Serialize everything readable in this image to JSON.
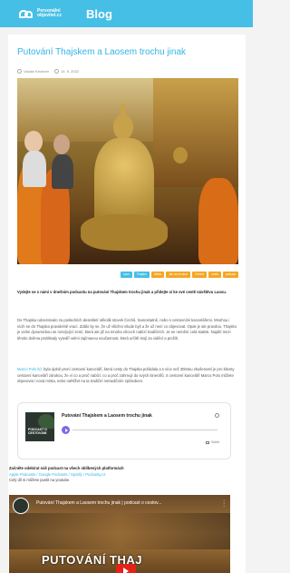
{
  "header": {
    "logo_text": "Personální\nobjevitel.cz",
    "title": "Blog"
  },
  "article": {
    "title": "Putování Thajskem a Laosem trochu jinak",
    "author": "Václav Kirchner",
    "date": "14. 9. 2022",
    "tags": [
      {
        "label": "Laos",
        "color": "blue"
      },
      {
        "label": "Thajsko",
        "color": "blue"
      },
      {
        "label": "Afrika",
        "color": "orange"
      },
      {
        "label": "Jak na revoluci",
        "color": "orange"
      },
      {
        "label": "Pohled",
        "color": "orange"
      },
      {
        "label": "cesta",
        "color": "orange"
      },
      {
        "label": "podcast",
        "color": "orange"
      }
    ],
    "intro": "Vydejte se s námi v dnešním podcastu na putování Thajskem trochu jinak a přidejte si ke své cestě návštěvu Laosu.",
    "para1": "Do Thajska odcestovalo za posledních desetiletí několik stovek Čechů. Samostatně, nebo s cestovními kancelářemi. Mnohou i vícih se do Thajska pravidelně vrací. Zdálo by se, že už všichni všude byli a že už není co objevovat. Opak je ale pravdou. Thajsko je velmi dynamickou se rozvíjející zemí, která ale již na mnoha věcech nabízí tradičních. Je se nemění celá statisti. Najdití mezi těmito dvěma protiklady vytváří velmi zajímavou současnost, která určitě stojí za vidění a prožití.",
    "para2_link": "Marco Polo ltd.",
    "para2": " byla úplně první cestovní kanceláří, která cesty do Thajska pořádala a s více než 30letou zkušeností je pro klienty cestovní kanceláří zárukou, že ví co a proč nabízí, co a proč zahrnují do svých itinerářů. S cestovní kanceláří Marco Polo můžete objevovat i nová místa, nebo nahlížet na ta tradiční netradičním způsobem."
  },
  "player": {
    "episode_title": "Putování Thajskem a Laosem trochu jinak",
    "cover_text": "PODCAST O CESTOVÁNÍ",
    "share_label": "Sdílet"
  },
  "subscribe": {
    "heading": "Začněte odebírat náš podcast na všech oblíbených platformách",
    "links": "Apple Podcasts / Google Podcasts / Spotify / Podcasty.cz",
    "note": "Celý díl si můžete pustit na youtube."
  },
  "video": {
    "title": "Putování Thajskem a Laosem trochu jinak | podcast o cestov...",
    "overlay_label": "PUTOVÁNÍ THAJ"
  },
  "colors": {
    "brand": "#46bfe6",
    "title": "#33b5e5",
    "tag_orange": "#f5a623",
    "youtube": "#e62117"
  }
}
